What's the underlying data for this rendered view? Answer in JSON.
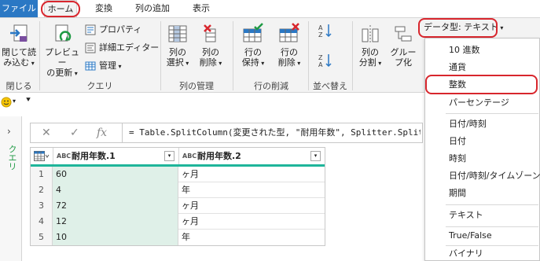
{
  "tabs": {
    "file": "ファイル",
    "home": "ホーム",
    "transform": "変換",
    "add_column": "列の追加",
    "view": "表示"
  },
  "ribbon": {
    "close_load": [
      "閉じて読",
      "み込む"
    ],
    "close_group": "閉じる",
    "preview_refresh": [
      "プレビュー",
      "の更新"
    ],
    "properties": "プロパティ",
    "advanced_editor": "詳細エディター",
    "manage": "管理",
    "query_group": "クエリ",
    "choose_columns": [
      "列の",
      "選択"
    ],
    "remove_columns": [
      "列の",
      "削除"
    ],
    "manage_columns_group": "列の管理",
    "keep_rows": [
      "行の",
      "保持"
    ],
    "remove_rows": [
      "行の",
      "削除"
    ],
    "reduce_rows_group": "行の削減",
    "sort_group": "並べ替え",
    "split_column": [
      "列の",
      "分割"
    ],
    "group_by": [
      "グルー",
      "プ化"
    ],
    "data_type": "データ型: テキスト"
  },
  "side_panel": {
    "label": "クエリ"
  },
  "formula": {
    "cancel": "✕",
    "commit": "✓",
    "fx": "fx",
    "text": "= Table.SplitColumn(変更された型, \"耐用年数\", Splitter.SplitTextByPositions"
  },
  "table": {
    "columns": [
      {
        "type": "ABC",
        "name": "耐用年数.1"
      },
      {
        "type": "ABC",
        "name": "耐用年数.2"
      }
    ],
    "rows": [
      [
        "1",
        "60",
        "ヶ月"
      ],
      [
        "2",
        "4",
        "年"
      ],
      [
        "3",
        "72",
        "ヶ月"
      ],
      [
        "4",
        "12",
        "ヶ月"
      ],
      [
        "5",
        "10",
        "年"
      ]
    ]
  },
  "type_menu": {
    "items": [
      "10 進数",
      "通貨",
      "整数",
      "パーセンテージ",
      "日付/時刻",
      "日付",
      "時刻",
      "日付/時刻/タイムゾーン",
      "期間",
      "テキスト",
      "True/False",
      "バイナリ"
    ],
    "highlighted": "整数"
  },
  "colors": {
    "file_tab": "#2b78c4",
    "highlight_ring": "#d8262d",
    "column_accent": "#1fb59a",
    "selected_column_bg": "#dff0e8"
  }
}
